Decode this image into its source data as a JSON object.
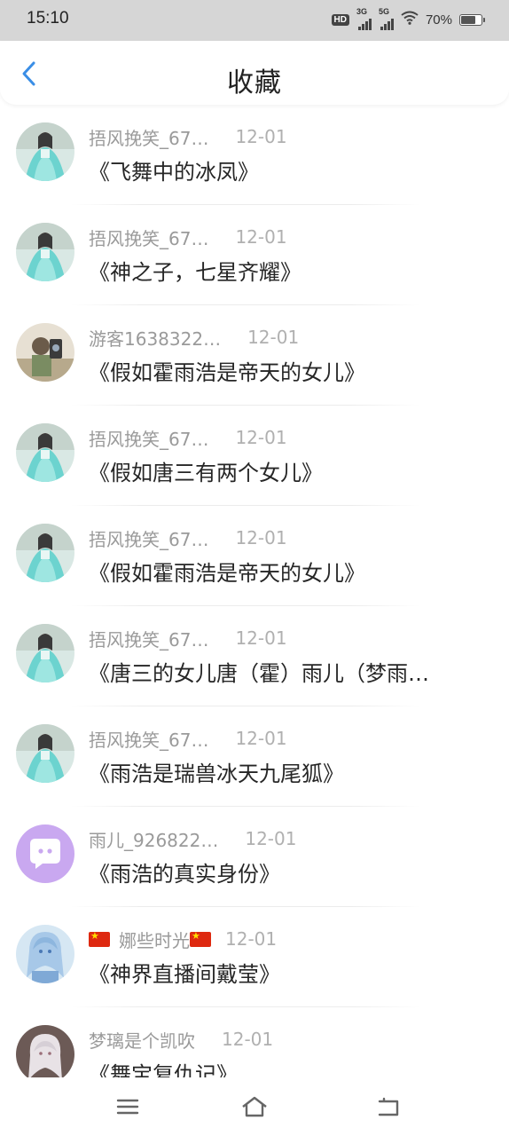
{
  "status_bar": {
    "time": "15:10",
    "hd_label": "HD",
    "net1_label": "3G",
    "net2_label": "5G",
    "battery_text": "70%",
    "battery_level": 0.7,
    "icons": [
      "hd-icon",
      "signal-3g-icon",
      "signal-5g-icon",
      "wifi-icon",
      "battery-icon"
    ]
  },
  "header": {
    "title": "收藏",
    "back_icon": "chevron-left-icon",
    "accent_color": "#3a8ee6"
  },
  "favorites": [
    {
      "author": "捂风挽笑_67…",
      "date": "12-01",
      "title": "《飞舞中的冰凤》",
      "avatar": "anime-girl-teal"
    },
    {
      "author": "捂风挽笑_67…",
      "date": "12-01",
      "title": "《神之子，七星齐耀》",
      "avatar": "anime-girl-teal"
    },
    {
      "author": "游客1638322…",
      "date": "12-01",
      "title": "《假如霍雨浩是帝天的女儿》",
      "avatar": "photo-girl"
    },
    {
      "author": "捂风挽笑_67…",
      "date": "12-01",
      "title": "《假如唐三有两个女儿》",
      "avatar": "anime-girl-teal"
    },
    {
      "author": "捂风挽笑_67…",
      "date": "12-01",
      "title": "《假如霍雨浩是帝天的女儿》",
      "avatar": "anime-girl-teal"
    },
    {
      "author": "捂风挽笑_67…",
      "date": "12-01",
      "title": "《唐三的女儿唐（霍）雨儿（梦雨…",
      "avatar": "anime-girl-teal"
    },
    {
      "author": "捂风挽笑_67…",
      "date": "12-01",
      "title": "《雨浩是瑞兽冰天九尾狐》",
      "avatar": "anime-girl-teal"
    },
    {
      "author": "雨儿_926822…",
      "date": "12-01",
      "title": "《雨浩的真实身份》",
      "avatar": "default-chat-bubble"
    },
    {
      "author": "娜些时光",
      "date": "12-01",
      "title": "《神界直播间戴莹》",
      "avatar": "anime-girl-blue",
      "flags": true
    },
    {
      "author": "梦璃是个凯吹",
      "date": "12-01",
      "title": "《舞宝复仇记》",
      "avatar": "anime-girl-white"
    }
  ],
  "nav_bar": {
    "icons": [
      "menu-icon",
      "home-icon",
      "back-icon"
    ]
  }
}
